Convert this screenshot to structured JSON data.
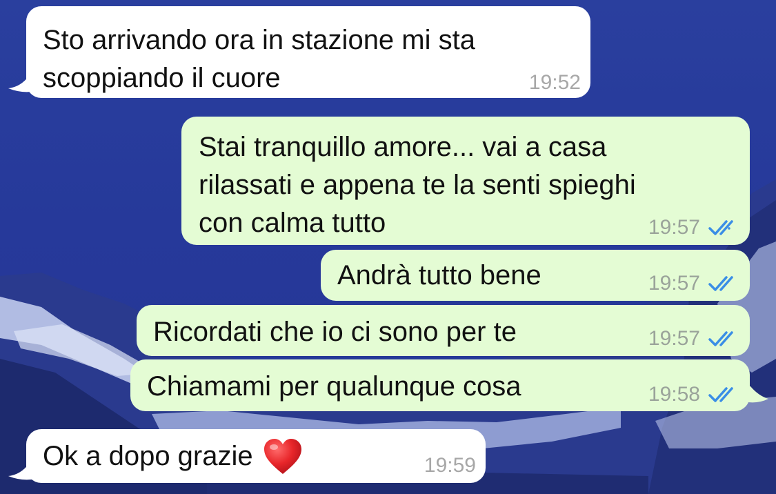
{
  "wallpaper": {
    "description_icon": "mountain-glacier-wallpaper"
  },
  "colors": {
    "incoming_bubble": "#ffffff",
    "outgoing_bubble": "#e4fcd4",
    "read_tick": "#3a8ee6",
    "timestamp": "#9aa39a"
  },
  "messages": [
    {
      "direction": "in",
      "text": "Sto arrivando ora in stazione mi sta\nscoppiando il cuore",
      "time": "19:52"
    },
    {
      "direction": "out",
      "text": "Stai tranquillo amore... vai a casa\nrilassati e appena te la senti spieghi\ncon calma tutto",
      "time": "19:57",
      "status_icon": "double-check-read-icon"
    },
    {
      "direction": "out",
      "text": "Andrà tutto bene",
      "time": "19:57",
      "status_icon": "double-check-read-icon"
    },
    {
      "direction": "out",
      "text": "Ricordati che io ci sono per te",
      "time": "19:57",
      "status_icon": "double-check-read-icon"
    },
    {
      "direction": "out",
      "text": "Chiamami per qualunque cosa",
      "time": "19:58",
      "status_icon": "double-check-read-icon"
    },
    {
      "direction": "in",
      "text": "Ok a dopo grazie",
      "emoji_icon": "red-heart-emoji",
      "time": "19:59"
    }
  ]
}
